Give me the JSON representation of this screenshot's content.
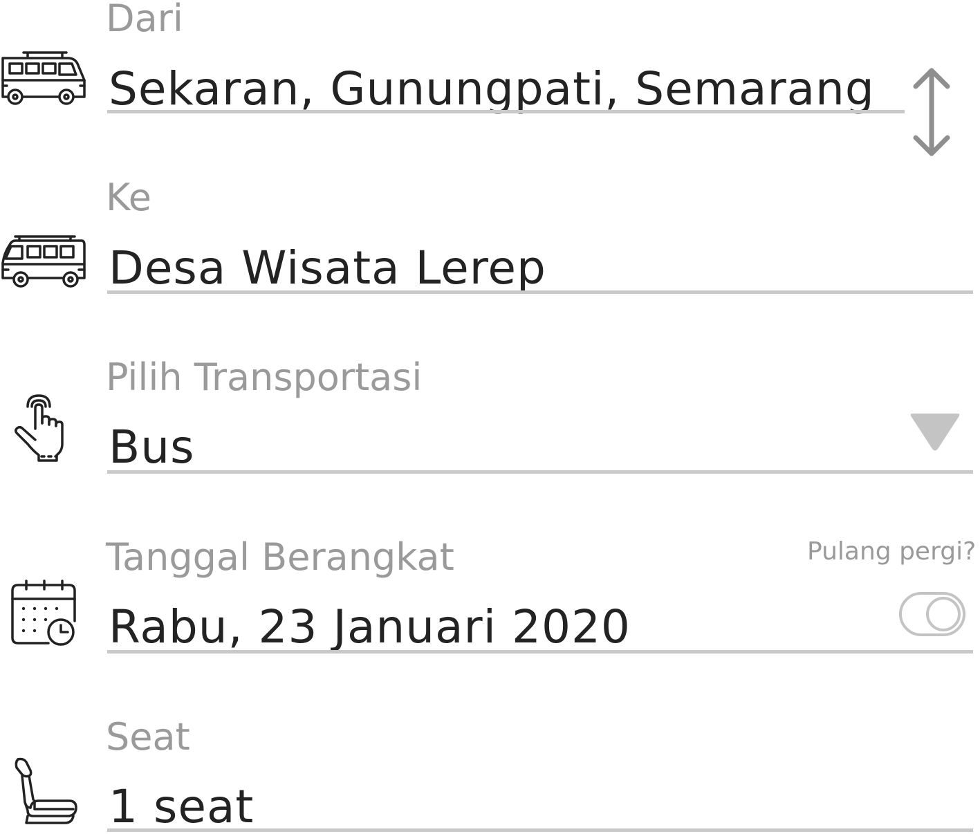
{
  "from": {
    "label": "Dari",
    "value": "Sekaran, Gunungpati, Semarang",
    "icon": "bus-icon",
    "action_icon": "swap-vertical-icon"
  },
  "to": {
    "label": "Ke",
    "value": "Desa Wisata Lerep",
    "icon": "bus-icon"
  },
  "transport": {
    "label": "Pilih Transportasi",
    "value": "Bus",
    "icon": "tap-hand-icon",
    "dropdown_icon": "triangle-down-icon"
  },
  "departure": {
    "label": "Tanggal Berangkat",
    "value": "Rabu, 23 Januari 2020",
    "icon": "calendar-clock-icon",
    "round_trip_label": "Pulang pergi?",
    "round_trip_enabled": false
  },
  "seat": {
    "label": "Seat",
    "value": "1 seat",
    "icon": "car-seat-icon"
  },
  "colors": {
    "label": "#9a9a9a",
    "value": "#232323",
    "underline": "#c9c9c9",
    "control": "#c4c4c4",
    "swap_arrow": "#8f8f8f"
  }
}
